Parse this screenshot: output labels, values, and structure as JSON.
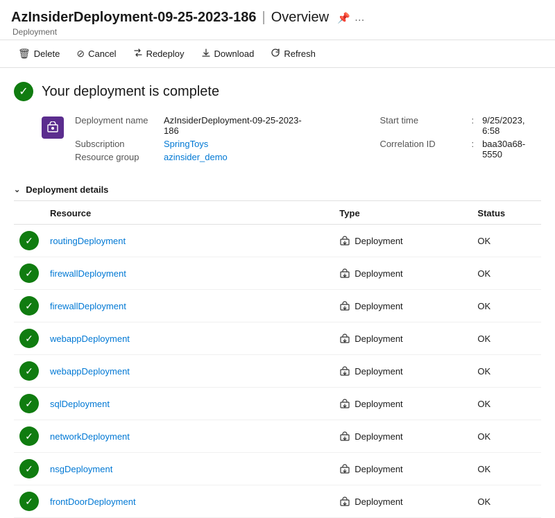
{
  "header": {
    "title": "AzInsiderDeployment-09-25-2023-186",
    "separator": "|",
    "page": "Overview",
    "subtitle": "Deployment",
    "pin_icon": "📌",
    "more_icon": "…"
  },
  "toolbar": {
    "buttons": [
      {
        "id": "delete",
        "label": "Delete",
        "icon": "🗑"
      },
      {
        "id": "cancel",
        "label": "Cancel",
        "icon": "⊘"
      },
      {
        "id": "redeploy",
        "label": "Redeploy",
        "icon": "⇅"
      },
      {
        "id": "download",
        "label": "Download",
        "icon": "⬇"
      },
      {
        "id": "refresh",
        "label": "Refresh",
        "icon": "↺"
      }
    ]
  },
  "status": {
    "message": "Your deployment is complete"
  },
  "deployment_info": {
    "left": [
      {
        "label": "Deployment name",
        "value": "AzInsiderDeployment-09-25-2023-186",
        "link": false
      },
      {
        "label": "Subscription",
        "value": "SpringToys",
        "link": true
      },
      {
        "label": "Resource group",
        "value": "azinsider_demo",
        "link": true
      }
    ],
    "right": [
      {
        "label": "Start time",
        "value": "9/25/2023, 6:58",
        "link": false
      },
      {
        "label": "Correlation ID",
        "value": "baa30a68-5550",
        "link": false
      }
    ]
  },
  "details_section": {
    "title": "Deployment details"
  },
  "table": {
    "columns": [
      "Resource",
      "Type",
      "Status"
    ],
    "rows": [
      {
        "resource": "routingDeployment",
        "type": "Deployment",
        "status": "OK"
      },
      {
        "resource": "firewallDeployment",
        "type": "Deployment",
        "status": "OK"
      },
      {
        "resource": "firewallDeployment",
        "type": "Deployment",
        "status": "OK"
      },
      {
        "resource": "webappDeployment",
        "type": "Deployment",
        "status": "OK"
      },
      {
        "resource": "webappDeployment",
        "type": "Deployment",
        "status": "OK"
      },
      {
        "resource": "sqlDeployment",
        "type": "Deployment",
        "status": "OK"
      },
      {
        "resource": "networkDeployment",
        "type": "Deployment",
        "status": "OK"
      },
      {
        "resource": "nsgDeployment",
        "type": "Deployment",
        "status": "OK"
      },
      {
        "resource": "frontDoorDeployment",
        "type": "Deployment",
        "status": "OK"
      }
    ]
  }
}
